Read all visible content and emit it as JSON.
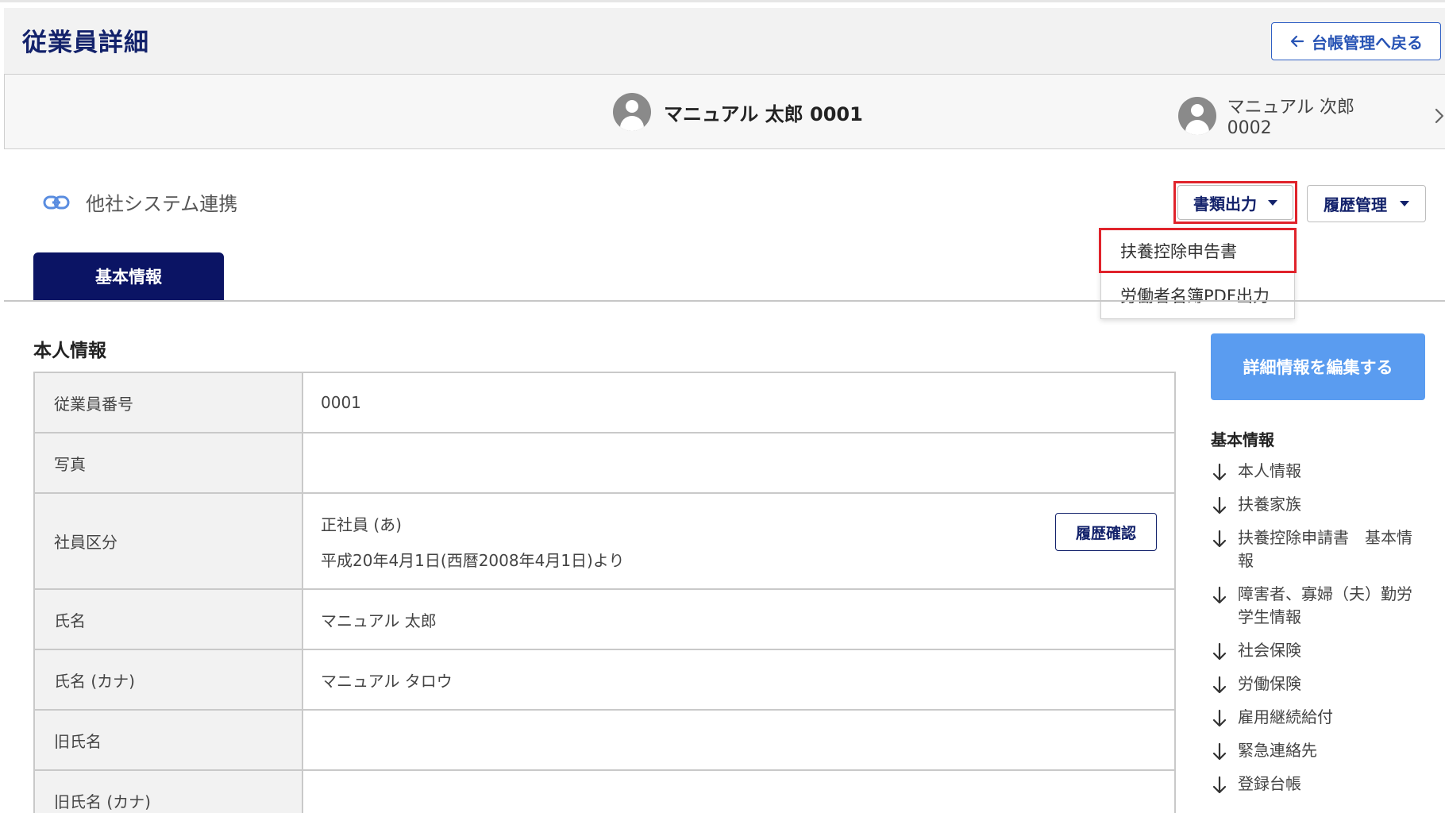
{
  "header": {
    "title": "従業員詳細",
    "back_label": "台帳管理へ戻る"
  },
  "employee_nav": {
    "current": {
      "name": "マニュアル 太郎 0001"
    },
    "next": {
      "name": "マニュアル 次郎　0002"
    }
  },
  "toolbar": {
    "integration_label": "他社システム連携",
    "documents_label": "書類出力",
    "history_label": "履歴管理",
    "documents_menu": [
      "扶養控除申告書",
      "労働者名簿PDF出力"
    ]
  },
  "tabs": [
    "基本情報"
  ],
  "section": {
    "title": "本人情報"
  },
  "table": {
    "rows": [
      {
        "label": "従業員番号",
        "value": "0001"
      },
      {
        "label": "写真",
        "value": ""
      },
      {
        "label": "社員区分",
        "value": "正社員 (あ)",
        "value2": "平成20年4月1日(西暦2008年4月1日)より",
        "action": "履歴確認"
      },
      {
        "label": "氏名",
        "value": "マニュアル 太郎"
      },
      {
        "label": "氏名 (カナ)",
        "value": "マニュアル タロウ"
      },
      {
        "label": "旧氏名",
        "value": ""
      },
      {
        "label": "旧氏名 (カナ)",
        "value": ""
      }
    ]
  },
  "sidebar": {
    "edit_label": "詳細情報を編集する",
    "heading": "基本情報",
    "items": [
      "本人情報",
      "扶養家族",
      "扶養控除申請書　基本情報",
      "障害者、寡婦（夫）勤労学生情報",
      "社会保険",
      "労働保険",
      "雇用継続給付",
      "緊急連絡先",
      "登録台帳"
    ]
  },
  "colors": {
    "primary_navy": "#13226b",
    "tab_bg": "#0b1464",
    "highlight_red": "#e0232b",
    "edit_blue": "#5a9cf0"
  }
}
